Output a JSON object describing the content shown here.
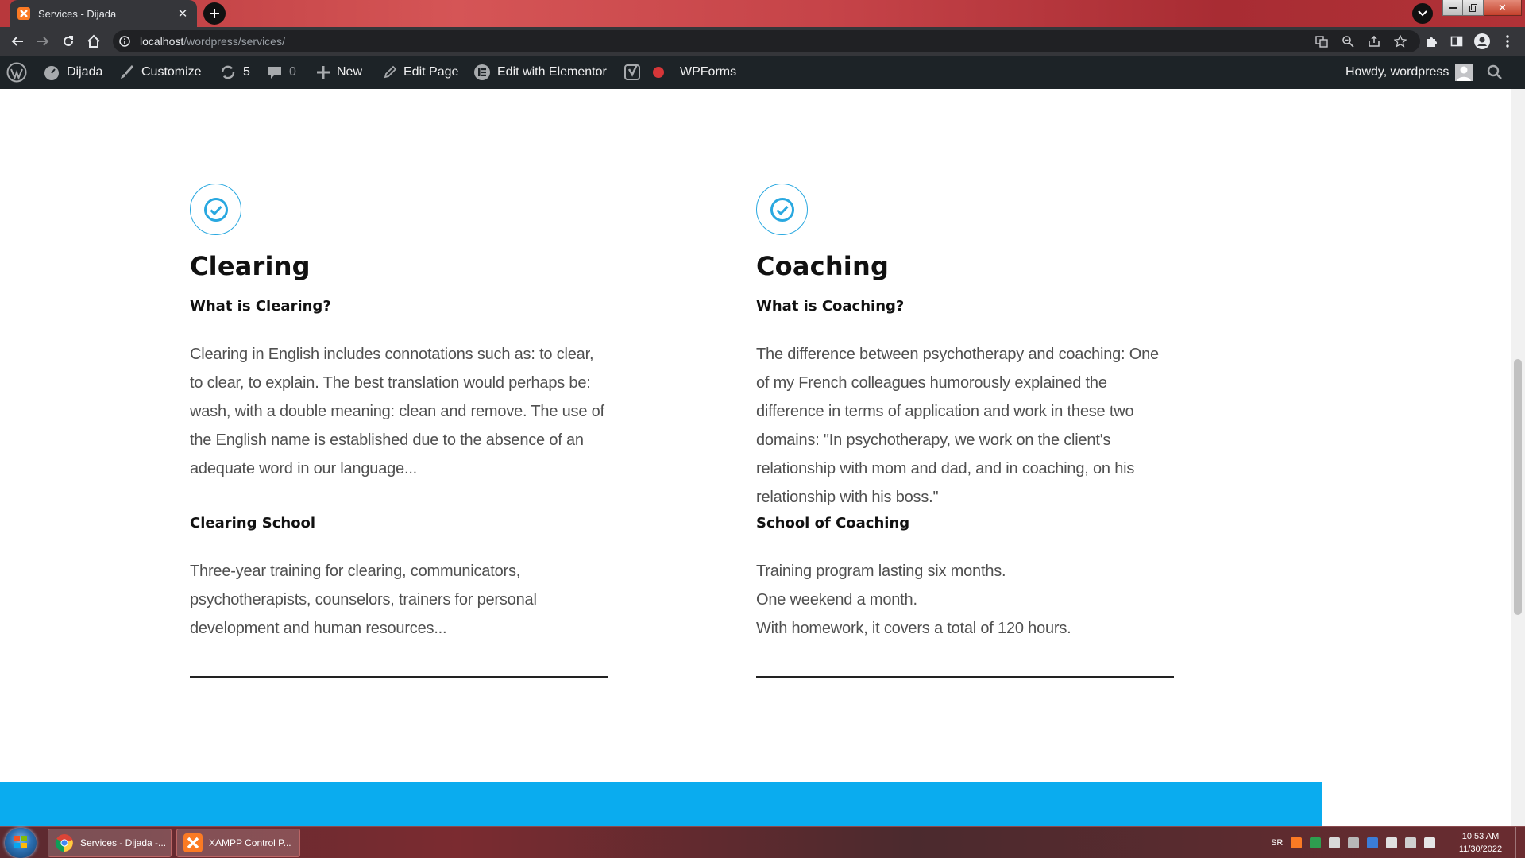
{
  "browser": {
    "tab_title": "Services - Dijada",
    "url_host": "localhost",
    "url_path": "/wordpress/services/"
  },
  "adminbar": {
    "site_name": "Dijada",
    "customize": "Customize",
    "updates_count": "5",
    "comments_count": "0",
    "new": "New",
    "edit_page": "Edit Page",
    "edit_elementor": "Edit with Elementor",
    "wpforms": "WPForms",
    "howdy": "Howdy, wordpress"
  },
  "services": [
    {
      "title": "Clearing",
      "q_heading": "What is Clearing?",
      "q_text": "Clearing in English includes connotations such as: to clear, to clear, to explain. The best translation would perhaps be: wash, with a double meaning: clean and remove. The use of the English name is established due to the absence of an adequate word in our language...",
      "school_heading": "Clearing School",
      "school_text": "Three-year training for clearing, communicators, psychotherapists, counselors, trainers for personal development and human resources..."
    },
    {
      "title": "Coaching",
      "q_heading": "What is Coaching?",
      "q_text": "The difference between psychotherapy and coaching: One of my French colleagues humorously explained the difference in terms of application and work in these two domains: \"In psychotherapy, we work on the client's relationship with mom and dad, and in coaching, on his relationship with his boss.\"",
      "school_heading": "School of Coaching",
      "school_lines": [
        "Training program lasting six months.",
        "One weekend a month.",
        "With homework, it covers a total of 120 hours."
      ]
    }
  ],
  "taskbar": {
    "task_chrome": "Services - Dijada -...",
    "task_xampp": "XAMPP Control P...",
    "lang": "SR",
    "time": "10:53 AM",
    "date": "11/30/2022"
  },
  "colors": {
    "accent_blue": "#0aacef",
    "check_blue": "#29a8e0",
    "adminbar": "#1d2327",
    "recording_dot": "#d63638"
  }
}
